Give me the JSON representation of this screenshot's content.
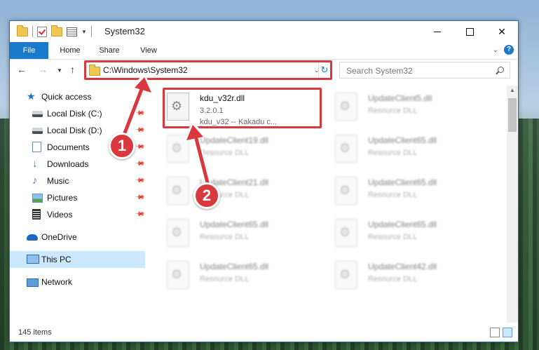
{
  "window": {
    "title": "System32"
  },
  "ribbon": {
    "tabs": [
      "File",
      "Home",
      "Share",
      "View"
    ],
    "help_label": "?"
  },
  "address": {
    "path": "C:\\Windows\\System32",
    "search_placeholder": "Search System32"
  },
  "sidebar": {
    "items": [
      {
        "label": "Quick access",
        "icon": "star-icon"
      },
      {
        "label": "Local Disk (C:)",
        "icon": "drive-icon",
        "pinned": true
      },
      {
        "label": "Local Disk (D:)",
        "icon": "drive-icon",
        "pinned": true
      },
      {
        "label": "Documents",
        "icon": "documents-icon",
        "pinned": true
      },
      {
        "label": "Downloads",
        "icon": "download-icon",
        "pinned": true
      },
      {
        "label": "Music",
        "icon": "music-icon",
        "pinned": true
      },
      {
        "label": "Pictures",
        "icon": "pictures-icon",
        "pinned": true
      },
      {
        "label": "Videos",
        "icon": "videos-icon",
        "pinned": true
      },
      {
        "label": "OneDrive",
        "icon": "cloud-icon"
      },
      {
        "label": "This PC",
        "icon": "computer-icon",
        "selected": true
      },
      {
        "label": "Network",
        "icon": "network-icon"
      }
    ]
  },
  "files": {
    "highlighted": {
      "name": "kdu_v32r.dll",
      "version": "3.2.0.1",
      "description": "kdu_v32 -- Kakadu c..."
    },
    "others": [
      {
        "name": "UpdateClient5.dll",
        "type": "Resource DLL"
      },
      {
        "name": "UpdateClient19.dll",
        "type": "Resource DLL"
      },
      {
        "name": "UpdateClient65.dll",
        "type": "Resource DLL"
      },
      {
        "name": "UpdateClient21.dll",
        "type": "Resource DLL"
      },
      {
        "name": "UpdateClient65.dll",
        "type": "Resource DLL"
      },
      {
        "name": "UpdateClient65.dll",
        "type": "Resource DLL"
      },
      {
        "name": "UpdateClient65.dll",
        "type": "Resource DLL"
      },
      {
        "name": "UpdateClient65.dll",
        "type": "Resource DLL"
      },
      {
        "name": "UpdateClient42.dll",
        "type": "Resource DLL"
      }
    ]
  },
  "status": {
    "item_count": "145 items"
  },
  "callouts": [
    "1",
    "2"
  ],
  "colors": {
    "accent": "#1979ca",
    "highlight": "#d9393e",
    "selection": "#cce8ff"
  }
}
